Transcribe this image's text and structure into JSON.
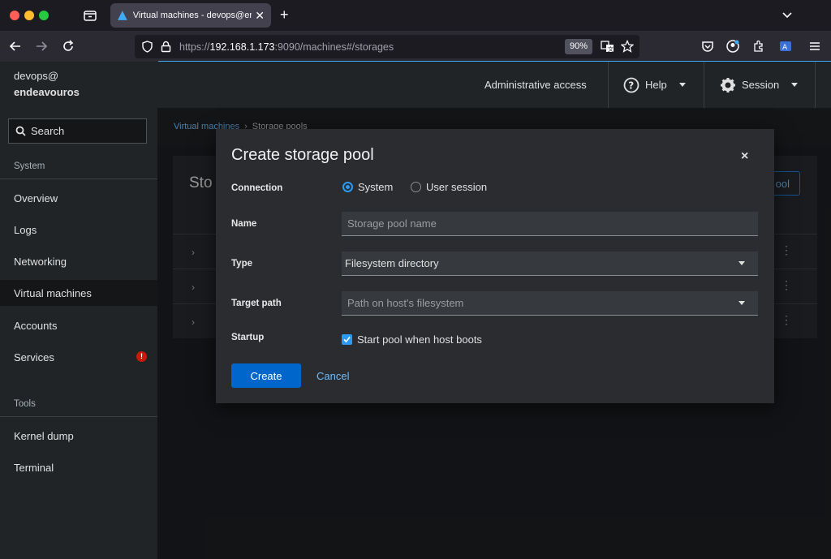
{
  "browser": {
    "tab_title": "Virtual machines - devops@endeavouros",
    "url_prefix": "https://",
    "url_host": "192.168.1.173",
    "url_rest": ":9090/machines#/storages",
    "zoom": "90%",
    "icons": [
      "tab-overview-icon",
      "close-icon",
      "plus-icon",
      "chevron-down-icon",
      "back-icon",
      "forward-icon",
      "reload-icon",
      "shield-icon",
      "lock-icon",
      "translate-icon",
      "star-icon",
      "pocket-icon",
      "account-icon",
      "extensions-icon",
      "menu-icon"
    ]
  },
  "sidebar": {
    "user": "devops@",
    "host": "endeavouros",
    "search_label": "Search",
    "groups": {
      "system": "System",
      "tools": "Tools"
    },
    "items": [
      {
        "label": "Overview"
      },
      {
        "label": "Logs"
      },
      {
        "label": "Networking"
      },
      {
        "label": "Virtual machines",
        "active": true
      },
      {
        "label": "Accounts"
      },
      {
        "label": "Services",
        "alert": "!"
      },
      {
        "label": "Kernel dump"
      },
      {
        "label": "Terminal"
      }
    ]
  },
  "masthead": {
    "admin": "Administrative access",
    "help": "Help",
    "session": "Session"
  },
  "breadcrumb": {
    "parent": "Virtual machines",
    "current": "Storage pools"
  },
  "card": {
    "title_fragment": "Sto",
    "button_fragment": "ool"
  },
  "modal": {
    "title": "Create storage pool",
    "close": "×",
    "connection_label": "Connection",
    "connection_options": [
      {
        "label": "System",
        "selected": true
      },
      {
        "label": "User session",
        "selected": false
      }
    ],
    "name_label": "Name",
    "name_placeholder": "Storage pool name",
    "type_label": "Type",
    "type_value": "Filesystem directory",
    "target_label": "Target path",
    "target_placeholder": "Path on host's filesystem",
    "startup_label": "Startup",
    "startup_checkbox": "Start pool when host boots",
    "startup_checked": true,
    "create": "Create",
    "cancel": "Cancel"
  },
  "colors": {
    "accent": "#0066cc",
    "link": "#73bcf7",
    "alert": "#c9190b"
  }
}
